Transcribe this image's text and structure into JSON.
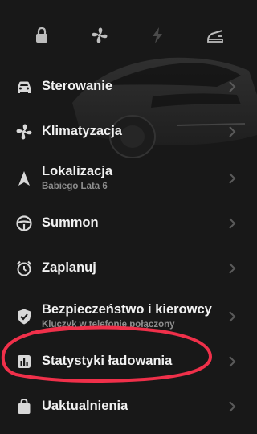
{
  "quick_actions": [
    {
      "icon": "lock-icon"
    },
    {
      "icon": "fan-icon"
    },
    {
      "icon": "lightning-icon"
    },
    {
      "icon": "frunk-icon"
    }
  ],
  "menu": {
    "items": [
      {
        "label": "Sterowanie",
        "icon": "car-icon"
      },
      {
        "label": "Klimatyzacja",
        "icon": "fan-icon"
      },
      {
        "label": "Lokalizacja",
        "sublabel": "Babiego Lata 6",
        "icon": "navigation-arrow-icon"
      },
      {
        "label": "Summon",
        "icon": "steering-wheel-icon"
      },
      {
        "label": "Zaplanuj",
        "icon": "alarm-clock-icon"
      },
      {
        "label": "Bezpieczeństwo i kierowcy",
        "sublabel": "Kluczyk w telefonie połączony",
        "icon": "shield-icon"
      },
      {
        "label": "Statystyki ładowania",
        "icon": "bar-chart-icon"
      },
      {
        "label": "Uaktualnienia",
        "icon": "shopping-bag-icon"
      }
    ]
  },
  "colors": {
    "background": "#181818",
    "text": "#f2f2f2",
    "subtext": "#8e8e8e",
    "icon": "#d8d8d8",
    "annotation": "#f0304a"
  }
}
